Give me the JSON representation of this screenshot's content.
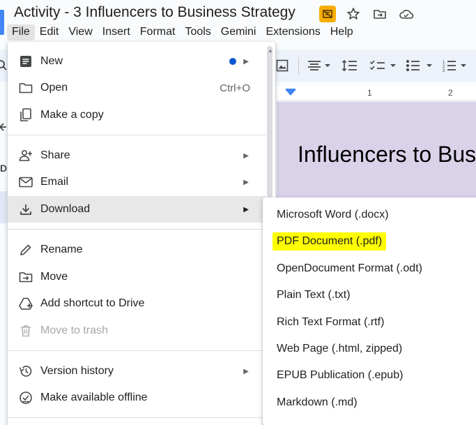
{
  "document": {
    "title": "Activity - 3 Influencers to Business Strategy",
    "page_heading": "Influencers to Bus",
    "left_panel_letter": "D"
  },
  "menubar": {
    "items": [
      "File",
      "Edit",
      "View",
      "Insert",
      "Format",
      "Tools",
      "Gemini",
      "Extensions",
      "Help"
    ]
  },
  "ruler": {
    "marks": [
      "1",
      "2"
    ]
  },
  "file_menu": {
    "new": "New",
    "open": "Open",
    "open_shortcut": "Ctrl+O",
    "make_copy": "Make a copy",
    "share": "Share",
    "email": "Email",
    "download": "Download",
    "rename": "Rename",
    "move": "Move",
    "add_shortcut": "Add shortcut to Drive",
    "move_to_trash": "Move to trash",
    "version_history": "Version history",
    "make_offline": "Make available offline"
  },
  "download_menu": {
    "items": [
      "Microsoft Word (.docx)",
      "PDF Document (.pdf)",
      "OpenDocument Format (.odt)",
      "Plain Text (.txt)",
      "Rich Text Format (.rtf)",
      "Web Page (.html, zipped)",
      "EPUB Publication (.epub)",
      "Markdown (.md)"
    ],
    "highlighted_index": 1
  },
  "colors": {
    "accent": "#0b57d0",
    "highlight": "#ffff00",
    "page_background": "#d9d2e9",
    "badge": "#f6ad06"
  }
}
